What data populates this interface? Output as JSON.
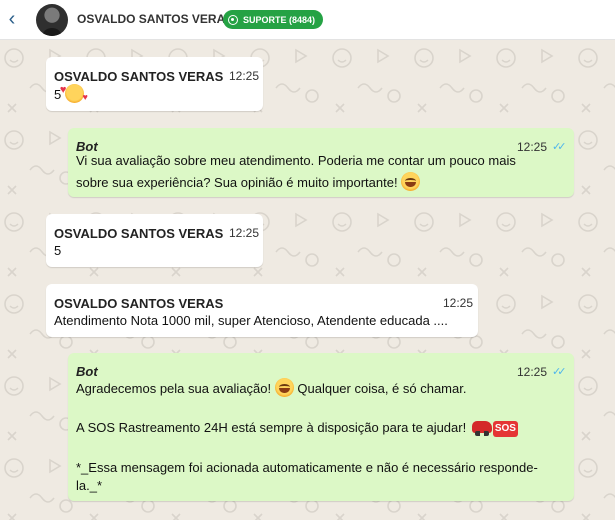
{
  "header": {
    "back_icon": "chevron-left-icon",
    "contact_name": "OSVALDO SANTOS VERAS",
    "support_badge": "SUPORTE (8484)",
    "badge_icon": "whatsapp-icon",
    "badge_color": "#25a244"
  },
  "colors": {
    "incoming_bubble": "#ffffff",
    "outgoing_bubble": "#dcf8c6",
    "chat_background": "#efeae2",
    "read_ticks": "#4fb6ec"
  },
  "messages": [
    {
      "direction": "incoming",
      "sender": "OSVALDO SANTOS VERAS",
      "time": "12:25",
      "text": "5",
      "emoji": "smiling-face-with-hearts"
    },
    {
      "direction": "outgoing",
      "sender": "Bot",
      "time": "12:25",
      "status": "read",
      "lines": [
        "Vi sua avaliação sobre meu atendimento. Poderia me contar um pouco mais",
        "sobre sua experiência? Sua opinião é muito importante!"
      ],
      "emoji": "smiling-face"
    },
    {
      "direction": "incoming",
      "sender": "OSVALDO SANTOS VERAS",
      "time": "12:25",
      "text": "5"
    },
    {
      "direction": "incoming",
      "sender": "OSVALDO SANTOS VERAS",
      "time": "12:25",
      "text": "Atendimento Nota 1000 mil, super Atencioso, Atendente educada ...."
    },
    {
      "direction": "outgoing",
      "sender": "Bot",
      "time": "12:25",
      "status": "read",
      "line1_a": "Agradecemos pela sua avaliação!",
      "line1_b": "Qualquer coisa, é só chamar.",
      "line2": "A SOS Rastreamento 24H está sempre à disposição para te ajudar!",
      "sos_badge": "SOS",
      "line3": "*_Essa mensagem foi acionada automaticamente e não é necessário responde-",
      "line4": "la._*"
    }
  ]
}
